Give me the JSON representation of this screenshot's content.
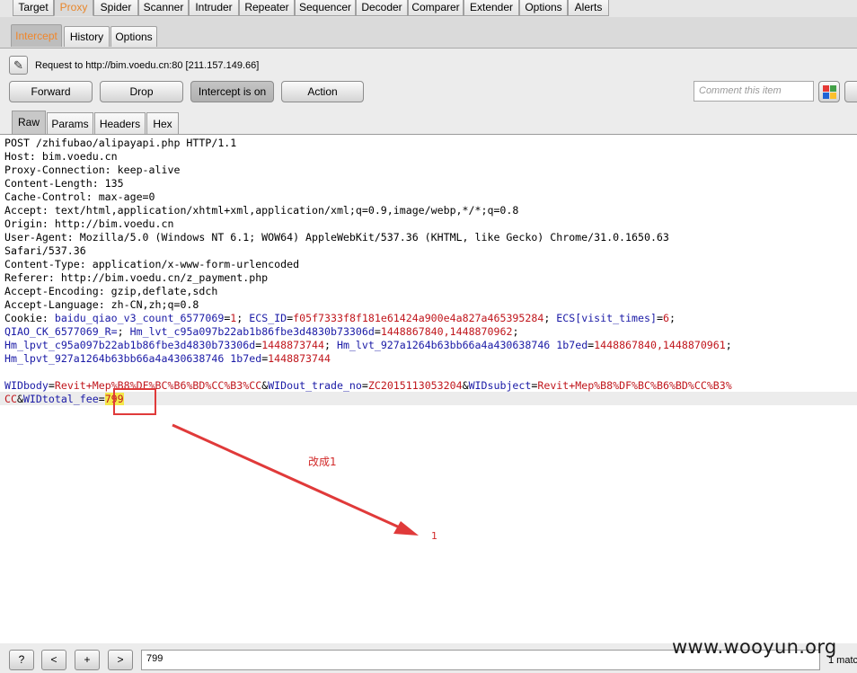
{
  "top_tabs": [
    "Target",
    "Proxy",
    "Spider",
    "Scanner",
    "Intruder",
    "Repeater",
    "Sequencer",
    "Decoder",
    "Comparer",
    "Extender",
    "Options",
    "Alerts"
  ],
  "sub_tabs": [
    "Intercept",
    "History",
    "Options"
  ],
  "request_info": "Request to http://bim.voedu.cn:80  [211.157.149.66]",
  "buttons": {
    "forward": "Forward",
    "drop": "Drop",
    "intercept": "Intercept is on",
    "action": "Action"
  },
  "comment_placeholder": "Comment this item",
  "message_tabs": [
    "Raw",
    "Params",
    "Headers",
    "Hex"
  ],
  "request_lines": [
    "POST /zhifubao/alipayapi.php HTTP/1.1",
    "Host: bim.voedu.cn",
    "Proxy-Connection: keep-alive",
    "Content-Length: 135",
    "Cache-Control: max-age=0",
    "Accept: text/html,application/xhtml+xml,application/xml;q=0.9,image/webp,*/*;q=0.8",
    "Origin: http://bim.voedu.cn",
    "User-Agent: Mozilla/5.0 (Windows NT 6.1; WOW64) AppleWebKit/537.36 (KHTML, like Gecko) Chrome/31.0.1650.63",
    "Safari/537.36",
    "Content-Type: application/x-www-form-urlencoded",
    "Referer: http://bim.voedu.cn/z_payment.php",
    "Accept-Encoding: gzip,deflate,sdch",
    "Accept-Language: zh-CN,zh;q=0.8"
  ],
  "cookie": {
    "label": "Cookie: ",
    "line1": [
      {
        "k": "baidu_qiao_v3_count_6577069",
        "v": "1"
      },
      {
        "k": "ECS_ID",
        "v": "f05f7333f8f181e61424a900e4a827a465395284"
      },
      {
        "k": "ECS[visit_times]",
        "v": "6"
      }
    ],
    "line2": [
      {
        "k": "QIAO_CK_6577069_R",
        "v": ""
      },
      {
        "k": "Hm_lvt_c95a097b22ab1b86fbe3d4830b73306d",
        "v": "1448867840,1448870962"
      }
    ],
    "line3": [
      {
        "k": "Hm_lpvt_c95a097b22ab1b86fbe3d4830b73306d",
        "v": "1448873744"
      },
      {
        "k": "Hm_lvt_927a1264b63bb66a4a430638746 1b7ed",
        "v": "1448867840,1448870961"
      }
    ],
    "line4": [
      {
        "k": "Hm_lpvt_927a1264b63bb66a4a430638746 1b7ed",
        "v": "1448873744"
      }
    ]
  },
  "body": {
    "p1k": "WIDbody",
    "p1v": "Revit+Mep%B8%DF%BC%B6%BD%CC%B3%CC",
    "p2k": "WIDout_trade_no",
    "p2v": "ZC2015113053204",
    "p3k": "WIDsubject",
    "p3v_a": "Revit+Mep%B8%DF%BC%B6%BD%CC%B3%",
    "p3v_b": "CC",
    "p4k": "WIDtotal_fee",
    "p4v": "799"
  },
  "annotation_text": "改成1",
  "annotation_number": "1",
  "search_value": "799",
  "matches_text": "1 matc",
  "watermark": "www.wooyun.org",
  "colors": {
    "accent_orange": "#e8862a",
    "header_blue": "#1a1aa6",
    "value_red": "#c0161c",
    "annotation_red": "#e03a3a",
    "highlight_yellow": "#f4e84a"
  }
}
